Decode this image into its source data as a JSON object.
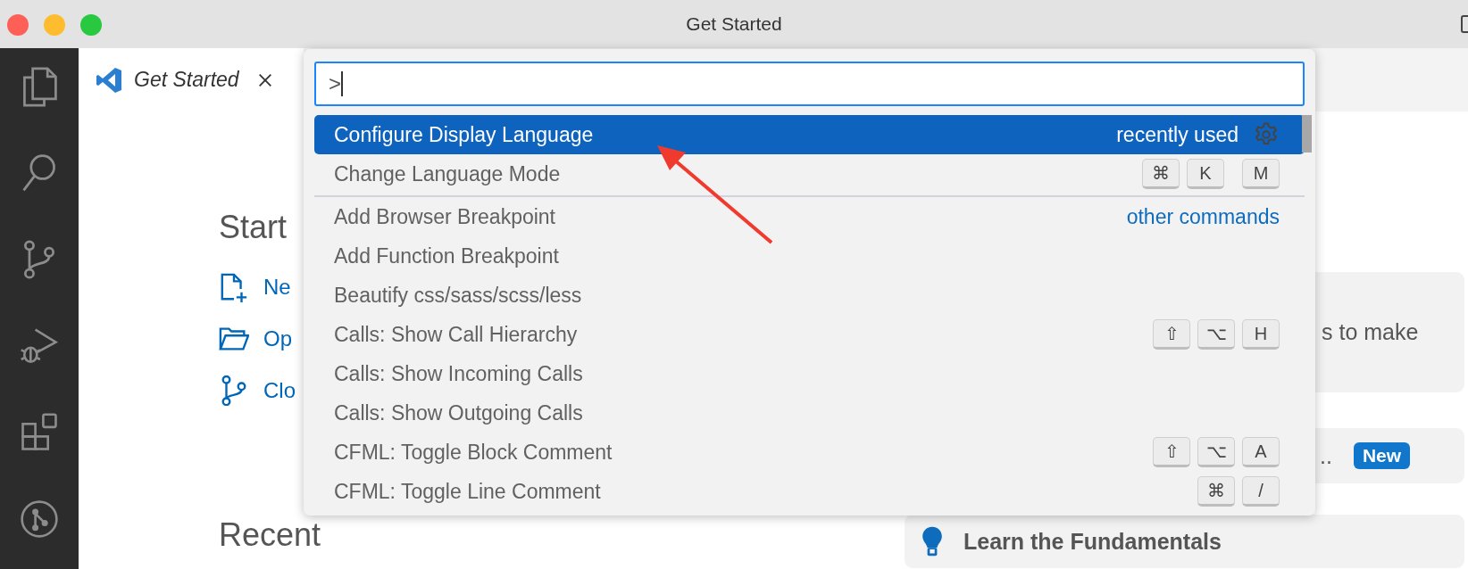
{
  "window": {
    "title": "Get Started"
  },
  "tab": {
    "label": "Get Started"
  },
  "start": {
    "heading": "Start",
    "items": [
      {
        "label": "Ne",
        "kind": "new-file"
      },
      {
        "label": "Op",
        "kind": "open-folder"
      },
      {
        "label": "Clo",
        "kind": "clone"
      }
    ]
  },
  "recent": {
    "heading": "Recent"
  },
  "walkthroughs": [
    {
      "text": "s to make",
      "kind": "plain"
    },
    {
      "text": "..",
      "kind": "new",
      "badge": "New"
    },
    {
      "text": "Learn the Fundamentals",
      "kind": "lightbulb"
    }
  ],
  "command_palette": {
    "value": ">",
    "items": [
      {
        "label": "Configure Display Language",
        "selected": true,
        "detail": "recently used"
      },
      {
        "label": "Change Language Mode",
        "selected": false,
        "keys": [
          [
            "⌘",
            "K"
          ],
          [
            "M"
          ]
        ]
      },
      {
        "label": "Add Browser Breakpoint",
        "selected": false,
        "group": "other commands"
      },
      {
        "label": "Add Function Breakpoint",
        "selected": false
      },
      {
        "label": "Beautify css/sass/scss/less",
        "selected": false
      },
      {
        "label": "Calls: Show Call Hierarchy",
        "selected": false,
        "keys": [
          [
            "⇧",
            "⌥",
            "H"
          ]
        ]
      },
      {
        "label": "Calls: Show Incoming Calls",
        "selected": false
      },
      {
        "label": "Calls: Show Outgoing Calls",
        "selected": false
      },
      {
        "label": "CFML: Toggle Block Comment",
        "selected": false,
        "keys": [
          [
            "⇧",
            "⌥",
            "A"
          ]
        ]
      },
      {
        "label": "CFML: Toggle Line Comment",
        "selected": false,
        "keys": [
          [
            "⌘",
            "/"
          ]
        ]
      }
    ]
  }
}
